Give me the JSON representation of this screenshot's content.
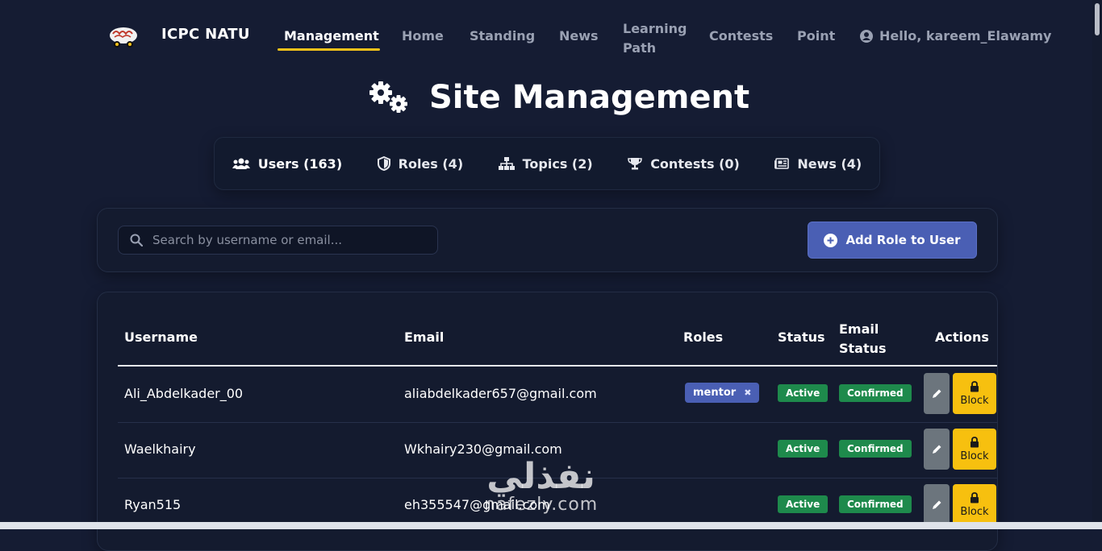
{
  "nav": {
    "brand": "ICPC NATU",
    "items": [
      {
        "label": "Management",
        "active": true
      },
      {
        "label": "Home"
      },
      {
        "label": "Standing"
      },
      {
        "label": "News"
      },
      {
        "label": "Learning",
        "label2": "Path"
      },
      {
        "label": "Contests"
      },
      {
        "label": "Point"
      }
    ],
    "user_greeting": "Hello, kareem_Elawamy"
  },
  "page": {
    "title": "Site Management"
  },
  "tabs": [
    {
      "label": "Users (163)",
      "icon": "users-icon",
      "active": true
    },
    {
      "label": "Roles (4)",
      "icon": "shield-icon"
    },
    {
      "label": "Topics (2)",
      "icon": "sitemap-icon"
    },
    {
      "label": "Contests (0)",
      "icon": "trophy-icon"
    },
    {
      "label": "News (4)",
      "icon": "newspaper-icon"
    }
  ],
  "search": {
    "placeholder": "Search by username or email..."
  },
  "add_role_button": "Add Role to User",
  "table": {
    "headers": {
      "username": "Username",
      "email": "Email",
      "roles": "Roles",
      "status": "Status",
      "email_status_1": "Email",
      "email_status_2": "Status",
      "actions": "Actions"
    },
    "rows": [
      {
        "username": "Ali_Abdelkader_00",
        "email": "aliabdelkader657@gmail.com",
        "role": "mentor",
        "status": "Active",
        "email_status": "Confirmed",
        "block": "Block"
      },
      {
        "username": "Waelkhairy",
        "email": "Wkhairy230@gmail.com",
        "role": "",
        "status": "Active",
        "email_status": "Confirmed",
        "block": "Block"
      },
      {
        "username": "Ryan515",
        "email": "eh355547@gmail.com",
        "role": "",
        "status": "Active",
        "email_status": "Confirmed",
        "block": "Block"
      }
    ]
  },
  "watermark": {
    "arabic": "نفذلي",
    "latin": "nafezly.com"
  },
  "colors": {
    "background": "#151c33",
    "accent": "#f4c21a",
    "primary": "#4a5fb4",
    "success": "#1e8a4c",
    "warning": "#f7c00f"
  }
}
